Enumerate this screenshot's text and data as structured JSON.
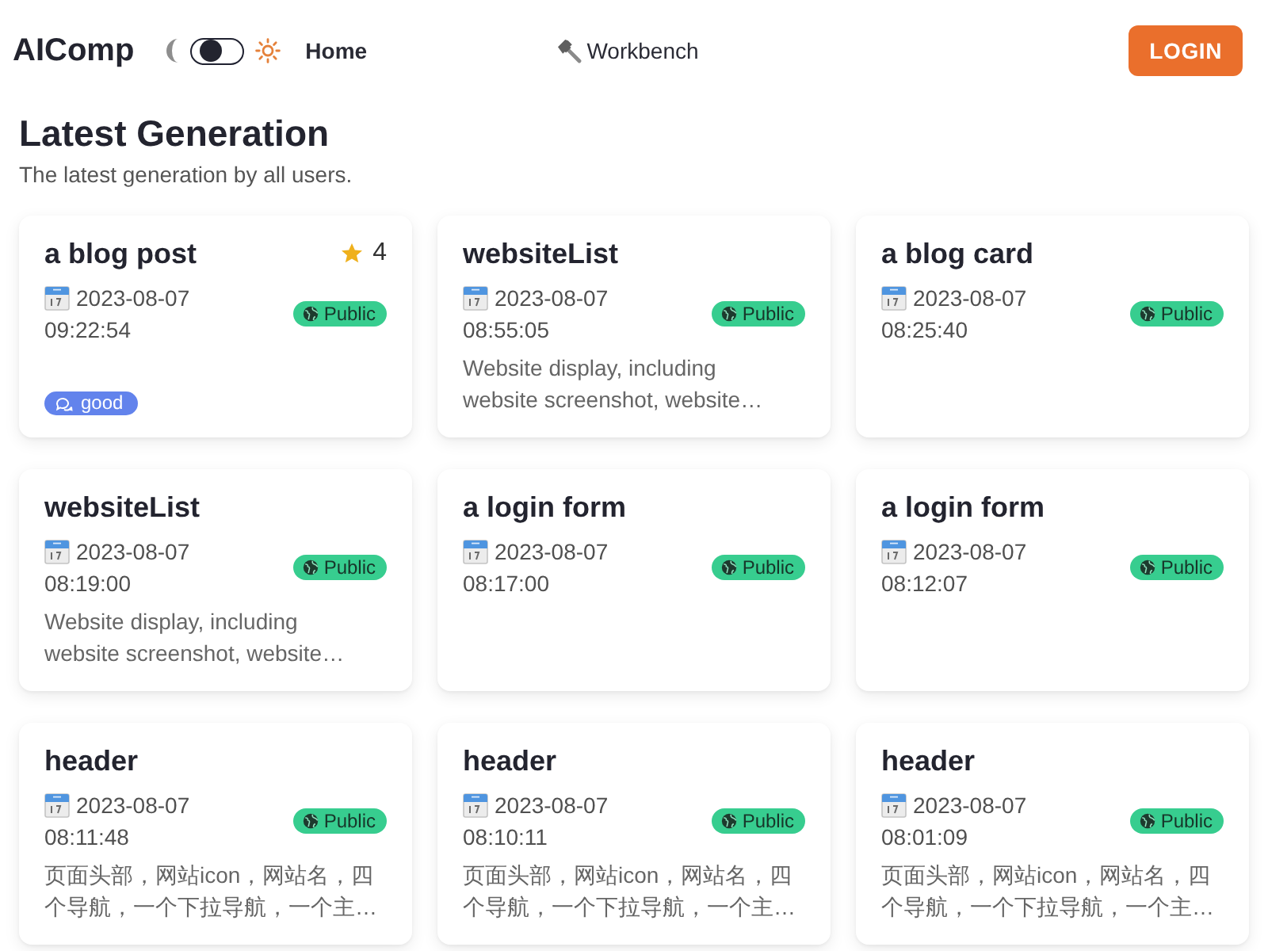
{
  "header": {
    "logo": "AIComp",
    "theme_toggle": {
      "on": false
    },
    "nav_start": [
      {
        "label": "Home",
        "selected": true,
        "kind": "text"
      }
    ],
    "nav_center": [
      {
        "label": "Workbench",
        "selected": false,
        "kind": "tool"
      }
    ],
    "login_button": "LOGIN"
  },
  "intro": {
    "title": "Latest Generation",
    "subtitle": "The latest generation by all users."
  },
  "cards": [
    {
      "title": "a blog post",
      "star_count": "4",
      "date": "2023-08-07",
      "time": "09:22:54",
      "visibility": "Public",
      "tags": [
        "good"
      ]
    },
    {
      "title": "websiteList",
      "date": "2023-08-07",
      "time": "08:55:05",
      "visibility": "Public",
      "description": "Website display, including website screenshot, website…"
    },
    {
      "title": "a blog card",
      "date": "2023-08-07",
      "time": "08:25:40",
      "visibility": "Public"
    },
    {
      "title": "websiteList",
      "date": "2023-08-07",
      "time": "08:19:00",
      "visibility": "Public",
      "description": "Website display, including website screenshot, website…"
    },
    {
      "title": "a login form",
      "date": "2023-08-07",
      "time": "08:17:00",
      "visibility": "Public"
    },
    {
      "title": "a login form",
      "date": "2023-08-07",
      "time": "08:12:07",
      "visibility": "Public"
    },
    {
      "title": "header",
      "date": "2023-08-07",
      "time": "08:11:48",
      "visibility": "Public",
      "description": "页面头部，网站icon，网站名，四个导航，一个下拉导航，一个主…"
    },
    {
      "title": "header",
      "date": "2023-08-07",
      "time": "08:10:11",
      "visibility": "Public",
      "description": "页面头部，网站icon，网站名，四个导航，一个下拉导航，一个主…"
    },
    {
      "title": "header",
      "date": "2023-08-07",
      "time": "08:01:09",
      "visibility": "Public",
      "description": "页面头部，网站icon，网站名，四个导航，一个下拉导航，一个主…"
    }
  ]
}
